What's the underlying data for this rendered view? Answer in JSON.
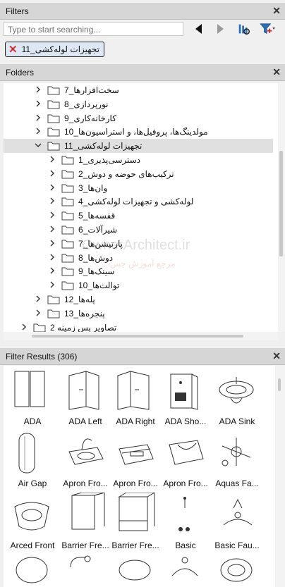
{
  "filters": {
    "title": "Filters",
    "search_placeholder": "Type to start searching...",
    "active_filter": "تجهیزات لوله‌کشی_11"
  },
  "folders": {
    "title": "Folders",
    "items": [
      {
        "label": "سخت‌افزارها_7"
      },
      {
        "label": "نورپردازی_8"
      },
      {
        "label": "کارخانه‌کاری_9"
      },
      {
        "label": "مولدینگ‌ها، پروفیل‌ها، و استراسیون‌ها_10"
      },
      {
        "label": "تجهیزات لوله‌کشی_11"
      },
      {
        "label": "دسترسی‌پذیری_1"
      },
      {
        "label": "ترکیب‌های حوضه و دوش_2"
      },
      {
        "label": "وان‌ها_3"
      },
      {
        "label": "لوله‌کشی و تجهیزات لوله‌کشی_4"
      },
      {
        "label": "قفسه‌ها_5"
      },
      {
        "label": "شیرآلات_6"
      },
      {
        "label": "پارتیشن‌ها_7"
      },
      {
        "label": "دوش‌ها_8"
      },
      {
        "label": "سینک‌ها_9"
      },
      {
        "label": "توالت‌ها_10"
      },
      {
        "label": "پله‌ها_12"
      },
      {
        "label": "پنجره‌ها_13"
      },
      {
        "label": "تصاویر پس زمینه 2"
      }
    ],
    "watermark_line1": "OwnerArchitect.ir",
    "watermark_line2": "مرجع آموزش جس..."
  },
  "results": {
    "title": "Filter Results (306)",
    "items": [
      {
        "label": "ADA"
      },
      {
        "label": "ADA Left"
      },
      {
        "label": "ADA Right"
      },
      {
        "label": "ADA Sho..."
      },
      {
        "label": "ADA Sink"
      },
      {
        "label": "Air Gap"
      },
      {
        "label": "Apron Fro..."
      },
      {
        "label": "Apron Fro..."
      },
      {
        "label": "Apron Fro..."
      },
      {
        "label": "Aquas Fa..."
      },
      {
        "label": "Arced Front"
      },
      {
        "label": "Barrier Fre..."
      },
      {
        "label": "Barrier Fre..."
      },
      {
        "label": "Basic"
      },
      {
        "label": "Basic Fau..."
      },
      {
        "label": ""
      },
      {
        "label": ""
      },
      {
        "label": ""
      },
      {
        "label": ""
      },
      {
        "label": ""
      }
    ]
  }
}
